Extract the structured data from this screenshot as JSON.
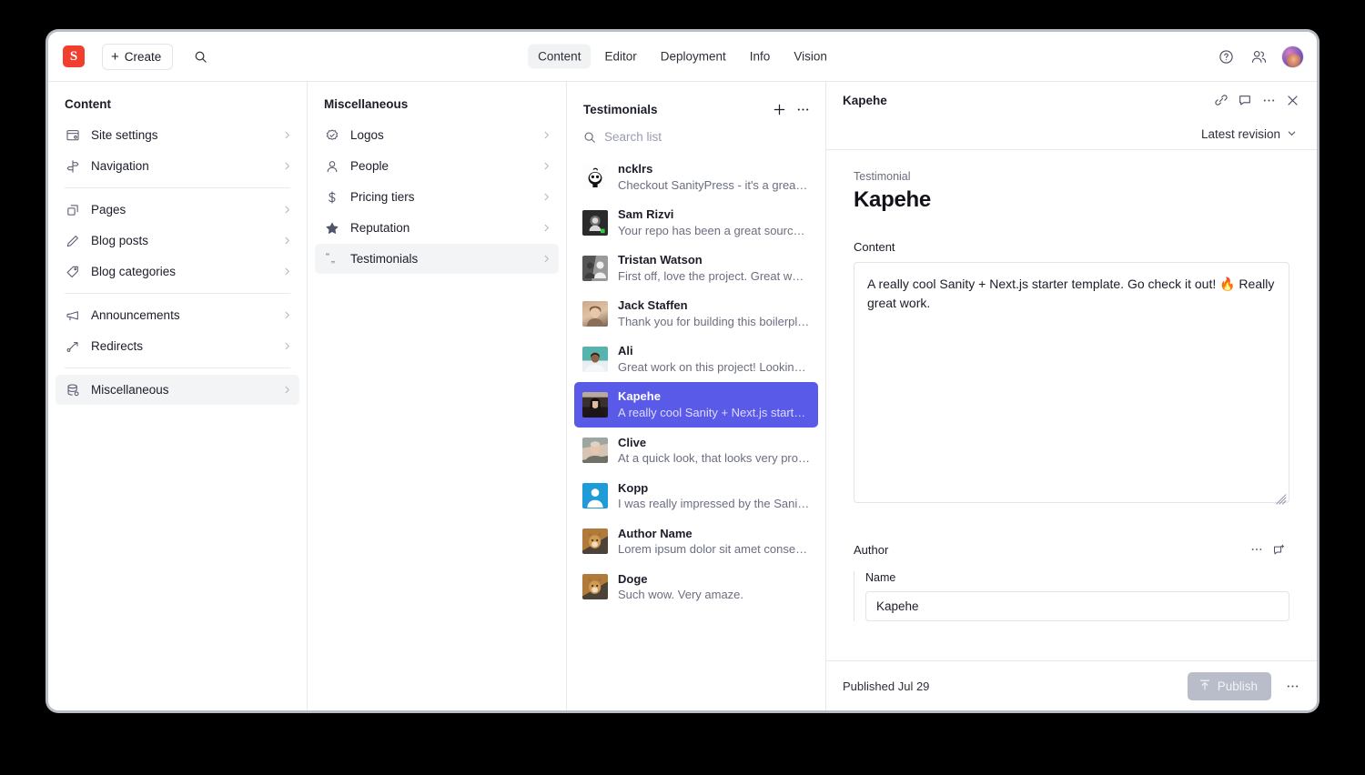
{
  "topbar": {
    "logo_letter": "S",
    "create_label": "Create",
    "search_icon": "search-icon",
    "tabs": [
      {
        "label": "Content",
        "active": true
      },
      {
        "label": "Editor",
        "active": false
      },
      {
        "label": "Deployment",
        "active": false
      },
      {
        "label": "Info",
        "active": false
      },
      {
        "label": "Vision",
        "active": false
      }
    ],
    "right_icons": [
      "help-circle-icon",
      "presence-people-icon",
      "user-avatar"
    ]
  },
  "content_pane": {
    "title": "Content",
    "items": [
      {
        "label": "Site settings",
        "icon": "site-settings-icon",
        "selected": false,
        "divider_after": false
      },
      {
        "label": "Navigation",
        "icon": "signpost-icon",
        "selected": false,
        "divider_after": true
      },
      {
        "label": "Pages",
        "icon": "pages-icon",
        "selected": false,
        "divider_after": false
      },
      {
        "label": "Blog posts",
        "icon": "pencil-icon",
        "selected": false,
        "divider_after": false
      },
      {
        "label": "Blog categories",
        "icon": "tag-icon",
        "selected": false,
        "divider_after": true
      },
      {
        "label": "Announcements",
        "icon": "megaphone-icon",
        "selected": false,
        "divider_after": false
      },
      {
        "label": "Redirects",
        "icon": "redirect-arrow-icon",
        "selected": false,
        "divider_after": true
      },
      {
        "label": "Miscellaneous",
        "icon": "database-icon",
        "selected": true,
        "divider_after": false
      }
    ]
  },
  "misc_pane": {
    "title": "Miscellaneous",
    "items": [
      {
        "label": "Logos",
        "icon": "badge-check-icon",
        "selected": false
      },
      {
        "label": "People",
        "icon": "user-icon",
        "selected": false
      },
      {
        "label": "Pricing tiers",
        "icon": "dollar-icon",
        "selected": false
      },
      {
        "label": "Reputation",
        "icon": "star-icon",
        "selected": false
      },
      {
        "label": "Testimonials",
        "icon": "quote-icon",
        "selected": true
      }
    ]
  },
  "list_pane": {
    "title": "Testimonials",
    "add_icon": "plus-icon",
    "more_icon": "ellipsis-icon",
    "search_placeholder": "Search list",
    "search_value": "",
    "items": [
      {
        "title": "ncklrs",
        "subtitle": "Checkout SanityPress - it's a great…",
        "avatar": "ncklrs-avatar",
        "selected": false
      },
      {
        "title": "Sam Rizvi",
        "subtitle": "Your repo has been a great source …",
        "avatar": "sam-rizvi-avatar",
        "selected": false
      },
      {
        "title": "Tristan Watson",
        "subtitle": "First off, love the project. Great wa…",
        "avatar": "tristan-watson-avatar",
        "selected": false
      },
      {
        "title": "Jack Staffen",
        "subtitle": "Thank you for building this boilerpl…",
        "avatar": "jack-staffen-avatar",
        "selected": false
      },
      {
        "title": "Ali",
        "subtitle": "Great work on this project! Looking…",
        "avatar": "ali-avatar",
        "selected": false
      },
      {
        "title": "Kapehe",
        "subtitle": "A really cool Sanity + Next.js starte…",
        "avatar": "kapehe-avatar",
        "selected": true
      },
      {
        "title": "Clive",
        "subtitle": "At a quick look, that looks very pro…",
        "avatar": "clive-avatar",
        "selected": false
      },
      {
        "title": "Kopp",
        "subtitle": "I was really impressed by the Sanit…",
        "avatar": "kopp-avatar",
        "selected": false
      },
      {
        "title": "Author Name",
        "subtitle": "Lorem ipsum dolor sit amet consec…",
        "avatar": "author-name-avatar",
        "selected": false
      },
      {
        "title": "Doge",
        "subtitle": "Such wow. Very amaze.",
        "avatar": "doge-avatar",
        "selected": false
      }
    ]
  },
  "document": {
    "header_title": "Kapehe",
    "header_icons": [
      "link-icon",
      "comment-icon",
      "ellipsis-icon",
      "close-icon"
    ],
    "revision_label": "Latest revision",
    "schema_label": "Testimonial",
    "title": "Kapehe",
    "content_label": "Content",
    "content_value": "A really cool Sanity + Next.js starter template. Go check it out! 🔥 Really great work.",
    "author_label": "Author",
    "author_icons": [
      "ellipsis-icon",
      "add-comment-icon"
    ],
    "author_name_label": "Name",
    "author_name_value": "Kapehe",
    "footer_status": "Published Jul 29",
    "publish_label": "Publish",
    "publish_icon": "publish-arrow-icon",
    "footer_more_icon": "ellipsis-icon"
  },
  "colors": {
    "accent_selected": "#5a5ae8",
    "brand_logo": "#f03e2f",
    "text_primary": "#1b1d29",
    "text_muted": "#6b6e80",
    "border": "#e7e8ec",
    "publish_disabled": "#b9bdc9"
  }
}
